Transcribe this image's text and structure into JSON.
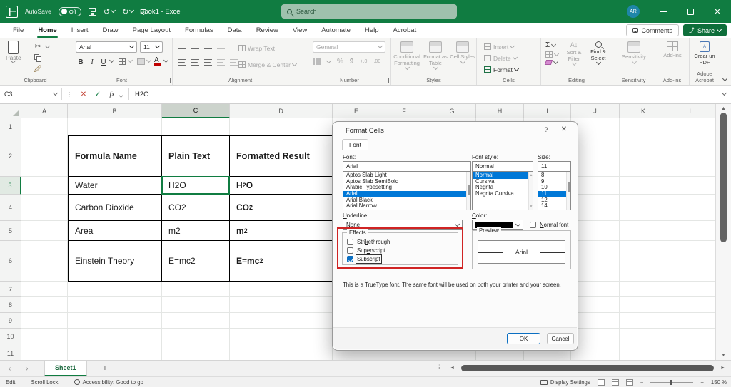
{
  "colors": {
    "accent_green": "#107C41",
    "selection_blue": "#0078D7",
    "annotation_red": "#D02424",
    "checkbox_blue": "#0B6FC2"
  },
  "titlebar": {
    "autosave_label": "AutoSave",
    "autosave_state": "Off",
    "doc_title": "Book1 - Excel",
    "search_placeholder": "Search",
    "avatar_initials": "AR"
  },
  "tabs": [
    {
      "label": "File"
    },
    {
      "label": "Home",
      "active": true
    },
    {
      "label": "Insert"
    },
    {
      "label": "Draw"
    },
    {
      "label": "Page Layout"
    },
    {
      "label": "Formulas"
    },
    {
      "label": "Data"
    },
    {
      "label": "Review"
    },
    {
      "label": "View"
    },
    {
      "label": "Automate"
    },
    {
      "label": "Help"
    },
    {
      "label": "Acrobat"
    }
  ],
  "top_actions": {
    "comments": "Comments",
    "share": "Share"
  },
  "ribbon": {
    "paste": "Paste",
    "font_name": "Arial",
    "font_size": "11",
    "wrap_text": "Wrap Text",
    "merge_center": "Merge & Center",
    "number_format": "General",
    "conditional_formatting": "Conditional Formatting",
    "format_as_table": "Format as Table",
    "cell_styles": "Cell Styles",
    "insert": "Insert",
    "delete": "Delete",
    "format": "Format",
    "sort_filter": "Sort & Filter",
    "find_select": "Find & Select",
    "sensitivity": "Sensitivity",
    "add_ins": "Add-ins",
    "acrobat_button": "Crear un PDF",
    "groups": {
      "clipboard": "Clipboard",
      "font": "Font",
      "alignment": "Alignment",
      "number": "Number",
      "styles": "Styles",
      "cells": "Cells",
      "editing": "Editing",
      "sensitivity": "Sensitivity",
      "addins": "Add-ins",
      "acrobat": "Adobe Acrobat"
    }
  },
  "formula_bar": {
    "cell_ref": "C3",
    "value": "H2O"
  },
  "grid": {
    "col_headers": [
      "A",
      "B",
      "C",
      "D",
      "E",
      "F",
      "G",
      "H",
      "I",
      "J",
      "K",
      "L"
    ],
    "active_col": "C",
    "row_headers": [
      "1",
      "2",
      "3",
      "4",
      "5",
      "6",
      "7",
      "8",
      "9",
      "10",
      "11"
    ],
    "active_row": "3",
    "table": {
      "headers": [
        "Formula Name",
        "Plain Text",
        "Formatted Result"
      ],
      "rows": [
        {
          "name": "Water",
          "plain": "H2O",
          "f_pre": "H",
          "f_script": "2",
          "f_post": "O",
          "script": "sub"
        },
        {
          "name": "Carbon Dioxide",
          "plain": "CO2",
          "f_pre": "CO",
          "f_script": "2",
          "f_post": "",
          "script": "sub"
        },
        {
          "name": "Area",
          "plain": "m2",
          "f_pre": "m",
          "f_script": "2",
          "f_post": "",
          "script": "sup"
        },
        {
          "name": "Einstein Theory",
          "plain": "E=mc2",
          "f_pre": "E=mc",
          "f_script": "2",
          "f_post": "",
          "script": "sup"
        }
      ]
    }
  },
  "dialog": {
    "title": "Format Cells",
    "tab": "Font",
    "labels": {
      "font": {
        "pre": "",
        "accel": "F",
        "post": "ont:"
      },
      "style": {
        "pre": "F",
        "accel": "o",
        "post": "nt style:"
      },
      "size": {
        "pre": "",
        "accel": "S",
        "post": "ize:"
      },
      "underline": {
        "pre": "",
        "accel": "U",
        "post": "nderline:"
      },
      "color": {
        "pre": "",
        "accel": "C",
        "post": "olor:"
      },
      "normal": {
        "pre": "",
        "accel": "N",
        "post": "ormal font"
      },
      "effects": "Effects",
      "preview": "Preview"
    },
    "font_value": "Arial",
    "font_list": [
      {
        "label": "Aptos Slab Light"
      },
      {
        "label": "Aptos Slab SemiBold"
      },
      {
        "label": "Arabic Typesetting"
      },
      {
        "label": "Arial",
        "selected": true
      },
      {
        "label": "Arial Black"
      },
      {
        "label": "Arial Narrow"
      }
    ],
    "style_value": "Normal",
    "style_list": [
      {
        "label": "Normal",
        "selected": true
      },
      {
        "label": "Cursiva"
      },
      {
        "label": "Negrita"
      },
      {
        "label": "Negrita Cursiva"
      }
    ],
    "size_value": "11",
    "size_list": [
      {
        "label": "8"
      },
      {
        "label": "9"
      },
      {
        "label": "10"
      },
      {
        "label": "11",
        "selected": true
      },
      {
        "label": "12"
      },
      {
        "label": "14"
      }
    ],
    "underline_value": "None",
    "effects": [
      {
        "pre": "Stri",
        "accel": "k",
        "post": "ethrough",
        "checked": false
      },
      {
        "pre": "Sup",
        "accel": "e",
        "post": "rscript",
        "checked": false
      },
      {
        "pre": "Su",
        "accel": "b",
        "post": "script",
        "checked": true
      }
    ],
    "preview_text": "Arial",
    "note": "This is a TrueType font.  The same font will be used on both your printer and your screen.",
    "ok": "OK",
    "cancel": "Cancel"
  },
  "sheet_bar": {
    "sheet": "Sheet1"
  },
  "status_bar": {
    "mode": "Edit",
    "scroll_lock": "Scroll Lock",
    "accessibility": "Accessibility: Good to go",
    "display_settings": "Display Settings",
    "zoom": "150 %"
  }
}
